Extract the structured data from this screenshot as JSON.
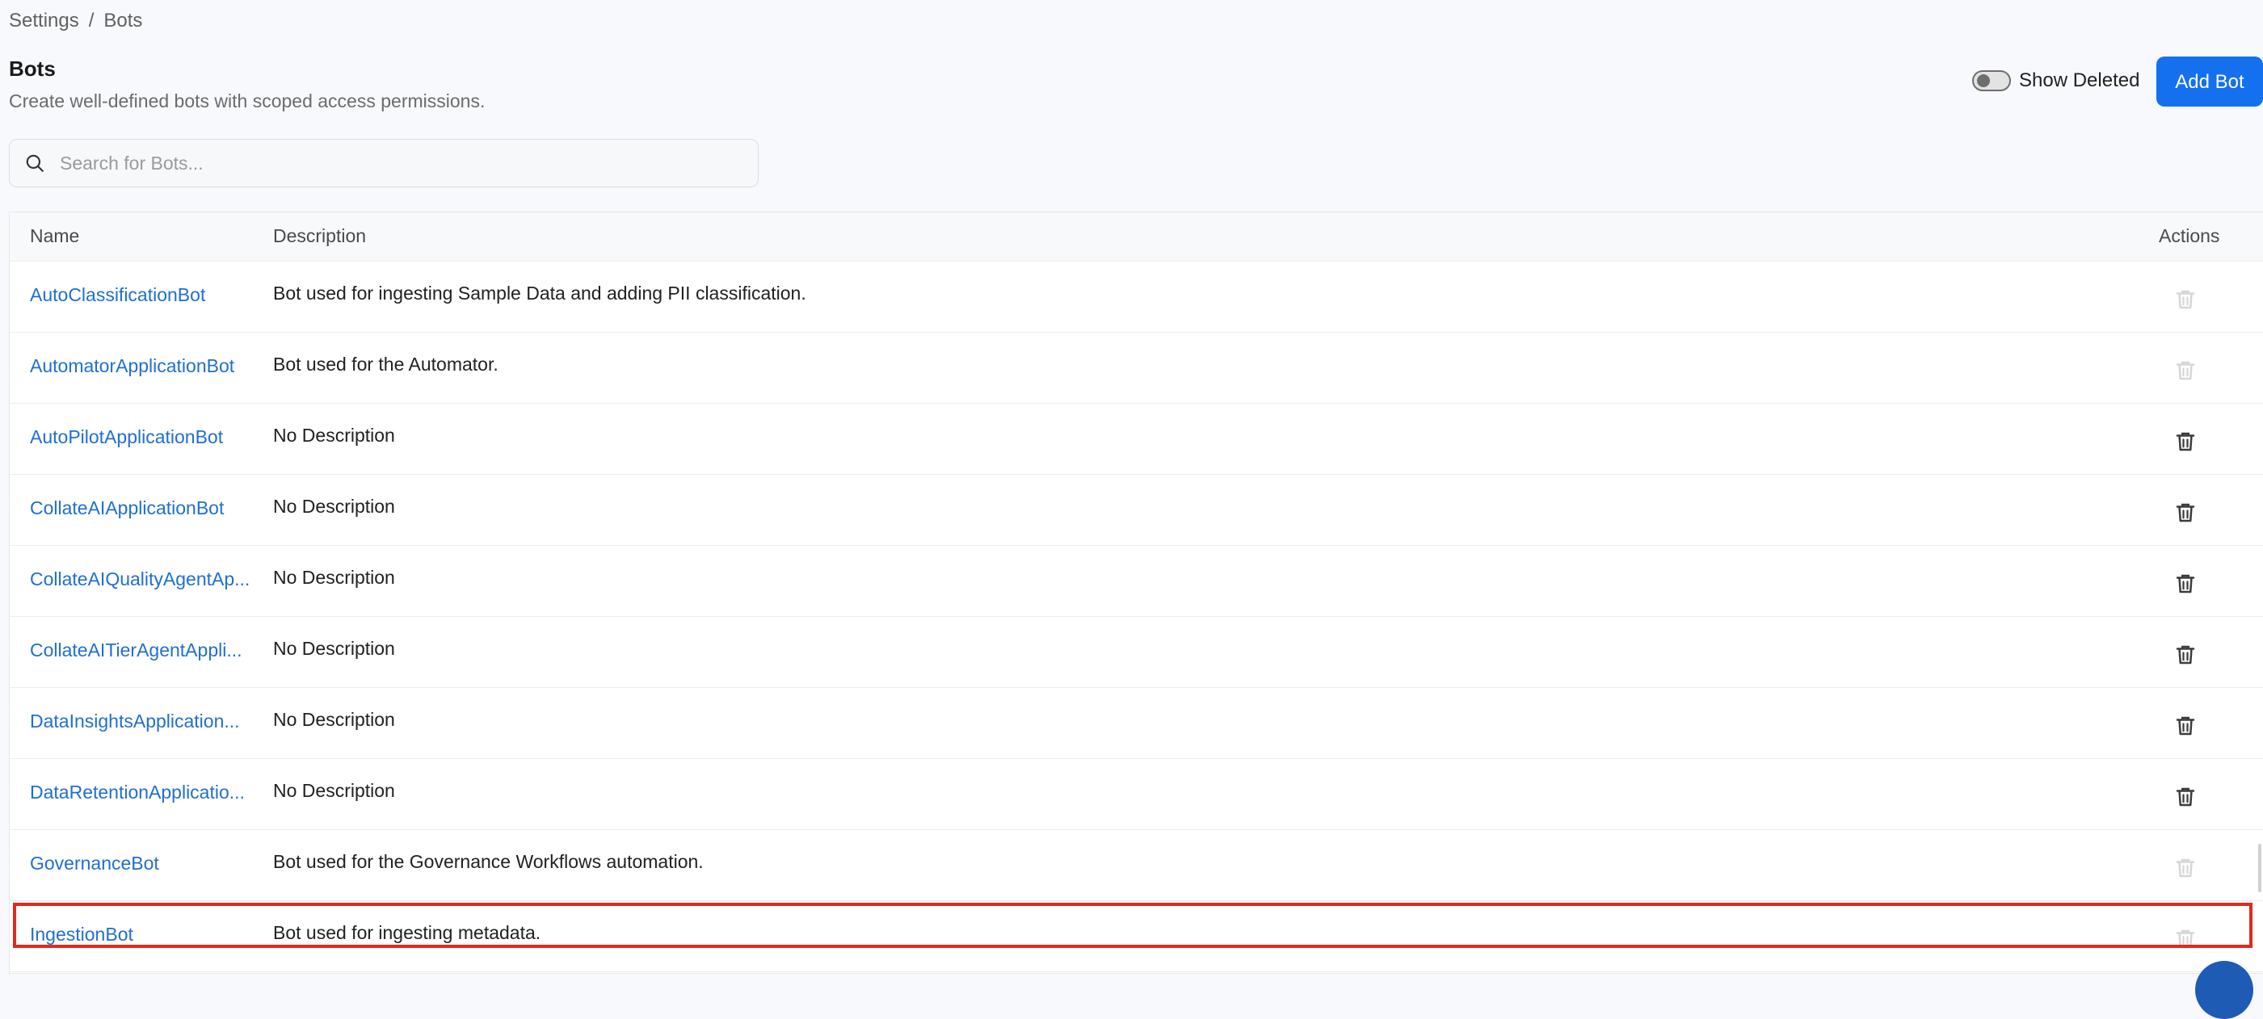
{
  "breadcrumb": {
    "parent": "Settings",
    "separator": "/",
    "current": "Bots"
  },
  "header": {
    "title": "Bots",
    "subtitle": "Create well-defined bots with scoped access permissions."
  },
  "toolbar": {
    "show_deleted_label": "Show Deleted",
    "show_deleted_on": false,
    "add_label": "Add Bot"
  },
  "search": {
    "placeholder": "Search for Bots...",
    "value": ""
  },
  "table": {
    "columns": {
      "name": "Name",
      "description": "Description",
      "actions": "Actions"
    },
    "rows": [
      {
        "name": "AutoClassificationBot",
        "description": "Bot used for ingesting Sample Data and adding PII classification.",
        "delete_enabled": false
      },
      {
        "name": "AutomatorApplicationBot",
        "description": "Bot used for the Automator.",
        "delete_enabled": false
      },
      {
        "name": "AutoPilotApplicationBot",
        "description": "No Description",
        "delete_enabled": true
      },
      {
        "name": "CollateAIApplicationBot",
        "description": "No Description",
        "delete_enabled": true
      },
      {
        "name": "CollateAIQualityAgentAp...",
        "description": "No Description",
        "delete_enabled": true
      },
      {
        "name": "CollateAITierAgentAppli...",
        "description": "No Description",
        "delete_enabled": true
      },
      {
        "name": "DataInsightsApplication...",
        "description": "No Description",
        "delete_enabled": true
      },
      {
        "name": "DataRetentionApplicatio...",
        "description": "No Description",
        "delete_enabled": true
      },
      {
        "name": "GovernanceBot",
        "description": "Bot used for the Governance Workflows automation.",
        "delete_enabled": false
      },
      {
        "name": "IngestionBot",
        "description": "Bot used for ingesting metadata.",
        "delete_enabled": false,
        "highlighted": true
      }
    ]
  },
  "colors": {
    "accent": "#1470ef",
    "link": "#1f6fd1",
    "highlight": "#e4281a",
    "disabled_icon": "#d6d6d6",
    "icon": "#3c3c3c"
  },
  "icons": {
    "search": "search-icon",
    "delete": "trash-icon"
  }
}
